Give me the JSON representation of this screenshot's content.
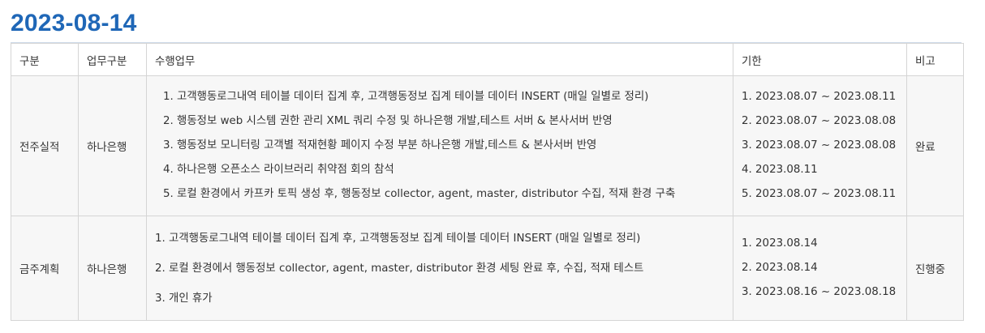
{
  "page": {
    "title": "2023-08-14"
  },
  "table": {
    "headers": {
      "category": "구분",
      "work_category": "업무구분",
      "tasks": "수행업무",
      "deadline": "기한",
      "remarks": "비고"
    },
    "rows": [
      {
        "category": "전주실적",
        "work_category": "하나은행",
        "tasks": [
          "1. 고객행동로그내역 테이블 데이터 집계 후, 고객행동정보 집계 테이블 데이터 INSERT (매일 일별로 정리)",
          "2. 행동정보 web 시스템 권한 관리 XML 쿼리 수정 및 하나은행 개발,테스트 서버 & 본사서버 반영",
          "3. 행동정보 모니터링 고객별 적재현황 페이지 수정 부분 하나은행 개발,테스트 & 본사서버 반영",
          "4. 하나은행 오픈소스 라이브러리 취약점 회의 참석",
          "5. 로컬 환경에서 카프카 토픽 생성 후, 행동정보 collector, agent, master, distributor 수집, 적재 환경 구축"
        ],
        "deadlines": [
          "1. 2023.08.07 ~ 2023.08.11",
          "2. 2023.08.07 ~ 2023.08.08",
          "3. 2023.08.07 ~ 2023.08.08",
          "4. 2023.08.11",
          "5. 2023.08.07 ~ 2023.08.11"
        ],
        "remarks": "완료"
      },
      {
        "category": "금주계획",
        "work_category": "하나은행",
        "tasks": [
          "1. 고객행동로그내역 테이블 데이터 집계 후, 고객행동정보 집계 테이블 데이터 INSERT (매일 일별로 정리)",
          "2. 로컬 환경에서 행동정보 collector, agent, master, distributor 환경 세팅 완료 후, 수집, 적재 테스트",
          "3. 개인 휴가"
        ],
        "deadlines": [
          "1. 2023.08.14",
          "2. 2023.08.14",
          "3. 2023.08.16 ~ 2023.08.18"
        ],
        "remarks": "진행중"
      }
    ]
  }
}
